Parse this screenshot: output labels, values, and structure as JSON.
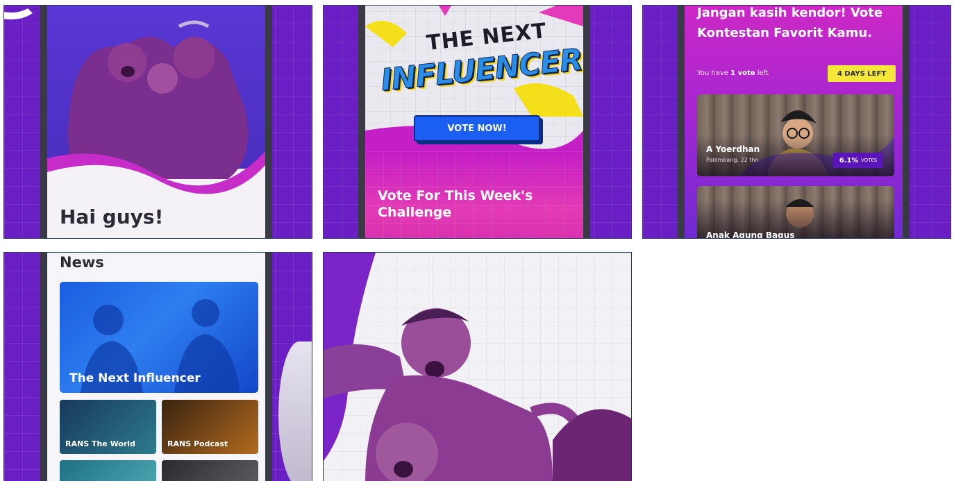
{
  "tiles": {
    "welcome": {
      "greeting": "Hai guys!"
    },
    "next_influencer": {
      "logo_top": "THE NEXT",
      "logo_main": "INFLUENCER",
      "vote_button": "VOTE NOW!",
      "challenge_heading": "Vote For This Week's Challenge"
    },
    "voting": {
      "heading": "Jangan kasih kendor! Vote Kontestan Favorit Kamu.",
      "vote_prefix": "You have ",
      "vote_count": "1 vote",
      "vote_suffix": " left",
      "days_left": "4 DAYS LEFT",
      "contestants": [
        {
          "name": "A Yoerdhan",
          "location": "Palembang, 22 thn",
          "votes": "6.1%",
          "votes_unit": "VOTES"
        },
        {
          "name": "Anak Agung Bagus"
        }
      ]
    },
    "news": {
      "title": "News",
      "featured": "The Next Influencer",
      "items": [
        "RANS The World",
        "RANS Podcast"
      ]
    }
  },
  "colors": {
    "brand_purple": "#6a1fc4",
    "brand_pink": "#d62dae",
    "vote_blue": "#1a5ef2",
    "highlight_yellow": "#f5e63a"
  }
}
